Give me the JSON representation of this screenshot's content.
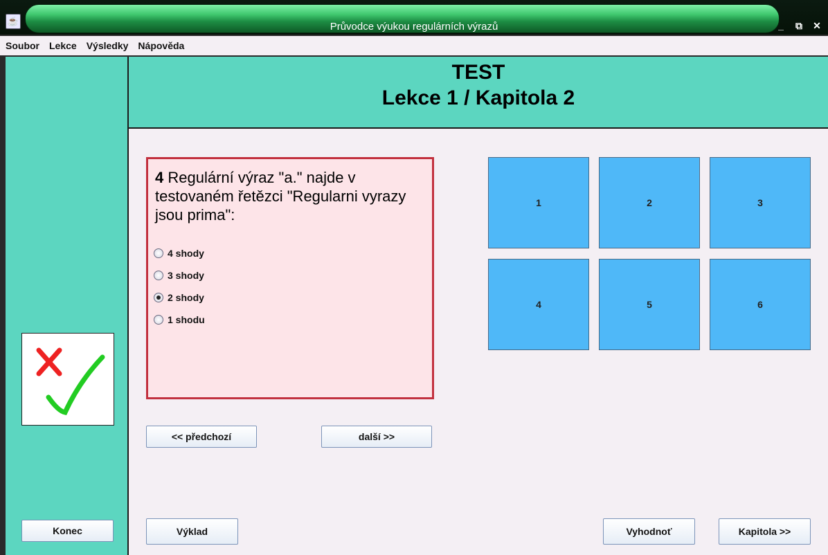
{
  "window": {
    "title": "Průvodce výukou regulárních výrazů",
    "controls": [
      "_",
      "⧉",
      "✕"
    ]
  },
  "menu": [
    "Soubor",
    "Lekce",
    "Výsledky",
    "Nápověda"
  ],
  "header": {
    "title": "TEST",
    "subtitle": "Lekce 1 / Kapitola 2"
  },
  "question": {
    "number": "4",
    "text": " Regulární výraz \"a.\" najde v testovaném řetězci \"Regularni vyrazy jsou prima\":",
    "options": [
      "4 shody",
      "3 shody",
      "2 shody",
      "1 shodu"
    ],
    "selected_index": 2
  },
  "tiles": [
    "1",
    "2",
    "3",
    "4",
    "5",
    "6"
  ],
  "buttons": {
    "prev": "<< předchozí",
    "next": "další >>",
    "end": "Konec",
    "explain": "Výklad",
    "evaluate": "Vyhodnoť",
    "chapter": "Kapitola >>"
  },
  "colors": {
    "panel_teal": "#5cd6c0",
    "tile_blue": "#4fb8f8",
    "question_border": "#c2303e",
    "question_bg": "#fde4e8",
    "cross_red": "#ee2222",
    "check_green": "#22cc22"
  },
  "icons": {
    "status": "cross-and-check-icon",
    "app": "java-cup-icon"
  }
}
